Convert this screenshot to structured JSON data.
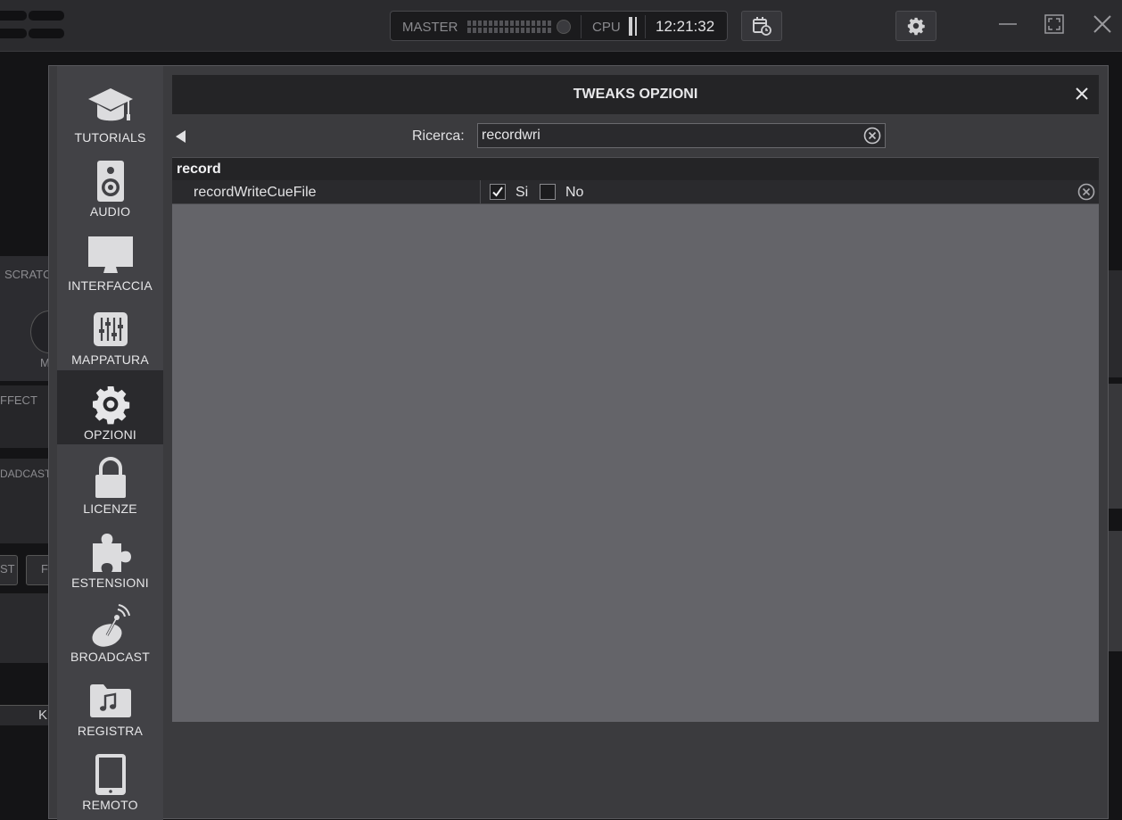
{
  "topbar": {
    "master_label": "MASTER",
    "cpu_label": "CPU",
    "clock": "12:21:32",
    "schedule_icon": "calendar-clock-icon",
    "settings_icon": "gear-icon"
  },
  "background": {
    "scratch": "SCRATC",
    "m": "M",
    "effect": "FFECT",
    "broadcast": "DADCAST",
    "st": "ST",
    "f": "F",
    "k": "K"
  },
  "dialog": {
    "title": "TWEAKS OPZIONI",
    "sidebar": [
      {
        "label": "TUTORIALS",
        "icon": "graduation-cap-icon"
      },
      {
        "label": "AUDIO",
        "icon": "speaker-icon"
      },
      {
        "label": "INTERFACCIA",
        "icon": "monitor-icon"
      },
      {
        "label": "MAPPATURA",
        "icon": "sliders-icon"
      },
      {
        "label": "OPZIONI",
        "icon": "gear-icon",
        "active": true
      },
      {
        "label": "LICENZE",
        "icon": "lock-icon"
      },
      {
        "label": "ESTENSIONI",
        "icon": "puzzle-icon"
      },
      {
        "label": "BROADCAST",
        "icon": "satellite-dish-icon"
      },
      {
        "label": "REGISTRA",
        "icon": "music-folder-icon"
      },
      {
        "label": "REMOTO",
        "icon": "tablet-icon"
      }
    ],
    "search": {
      "label": "Ricerca:",
      "value": "recordwri"
    },
    "group": "record",
    "option": {
      "name": "recordWriteCueFile",
      "yes_label": "Si",
      "no_label": "No",
      "yes_checked": true,
      "no_checked": false
    }
  },
  "colors": {
    "dialog_bg": "#3b3b3e",
    "list_bg": "#646469",
    "title_bg": "#242426",
    "active_nav": "#2a2a2d"
  }
}
